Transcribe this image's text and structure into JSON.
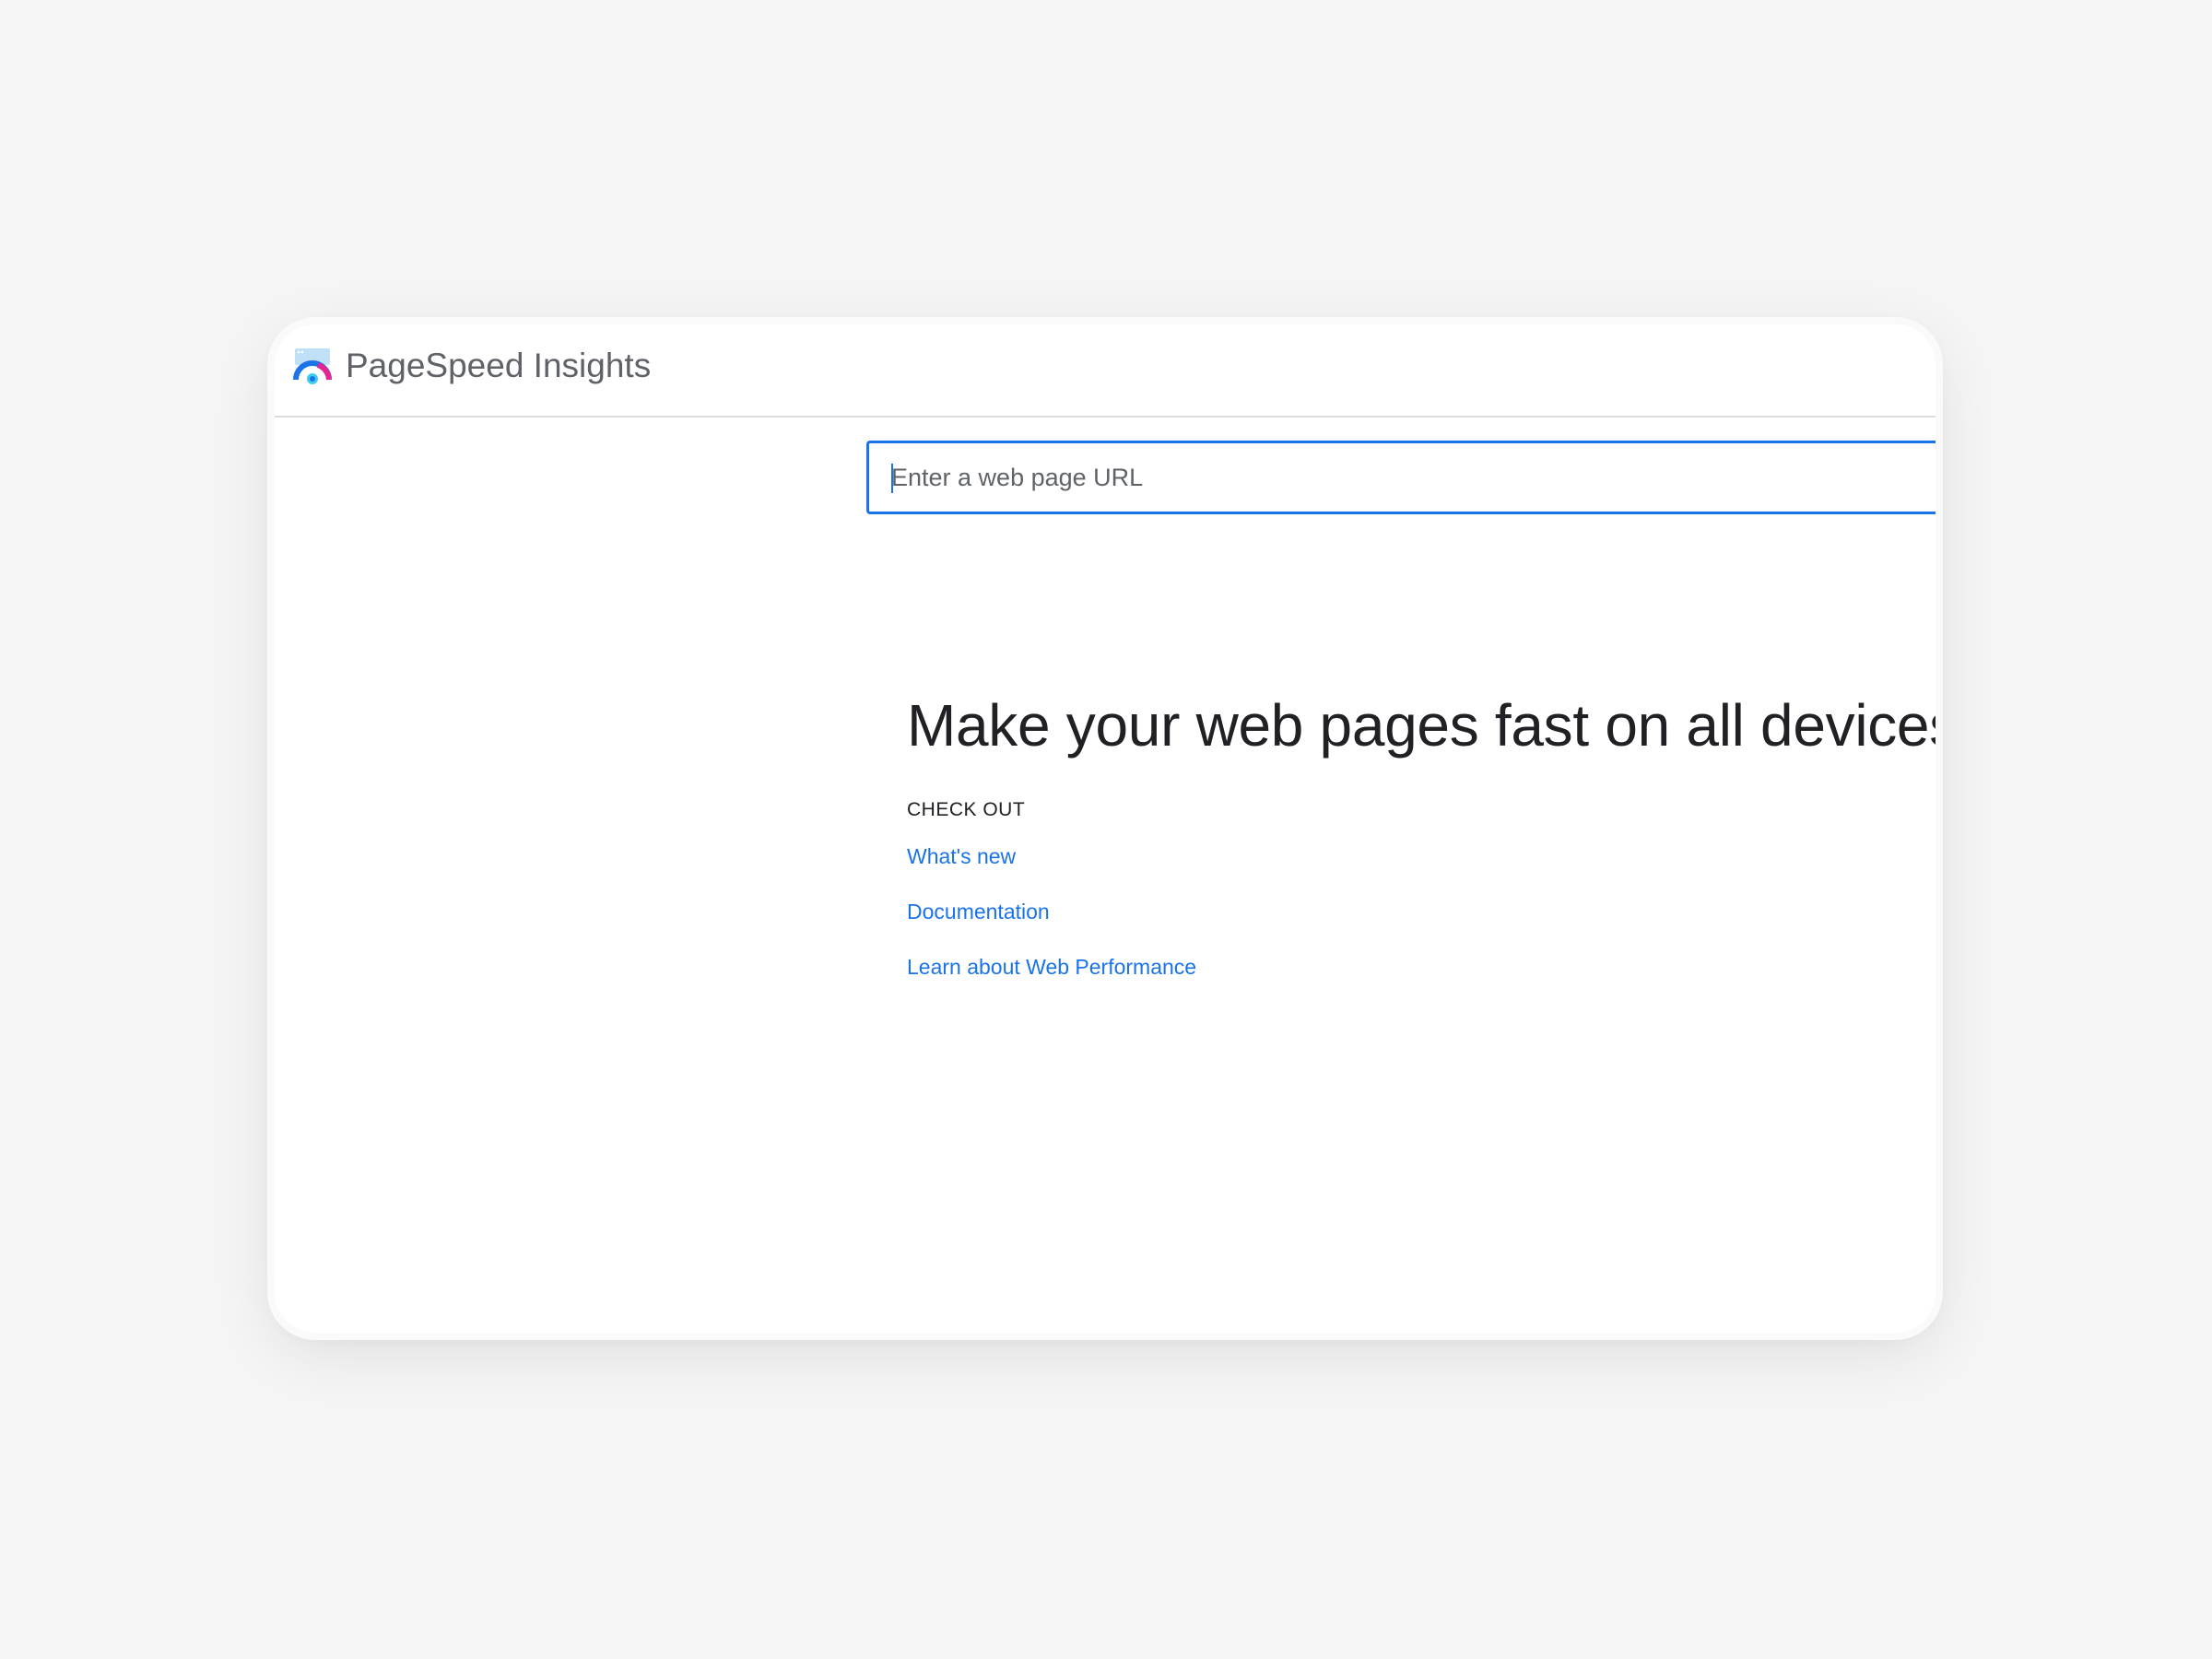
{
  "header": {
    "app_title": "PageSpeed Insights",
    "logo_icon": "pagespeed-gauge-icon"
  },
  "search": {
    "placeholder": "Enter a web page URL",
    "value": ""
  },
  "main": {
    "headline": "Make your web pages fast on all devices",
    "check_out_label": "CHECK OUT",
    "links": [
      {
        "label": "What's new"
      },
      {
        "label": "Documentation"
      },
      {
        "label": "Learn about Web Performance"
      }
    ]
  },
  "colors": {
    "accent": "#1a73e8",
    "title_gray": "#5f6368",
    "text": "#202124",
    "background": "#f5f5f5"
  }
}
